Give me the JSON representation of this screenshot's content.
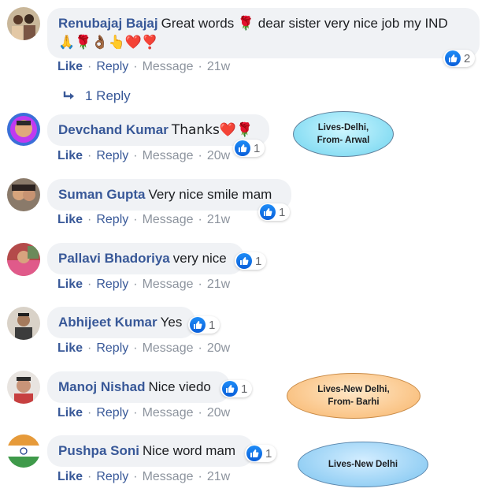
{
  "actions": {
    "like": "Like",
    "reply": "Reply",
    "message": "Message",
    "sep": "·"
  },
  "comments": [
    {
      "name": "Renubajaj Bajaj",
      "text_line1": "Great words 🌹 dear sister very nice job my IND",
      "text_line2": "🙏🌹👌🏾👆❤️❣️",
      "reactions": "2",
      "time": "21w",
      "replies_link": "1 Reply"
    },
    {
      "name": "Devchand Kumar",
      "text": "Thanks❤️🌹",
      "reactions": "1",
      "time": "20w"
    },
    {
      "name": "Suman Gupta",
      "text": "Very nice smile mam",
      "reactions": "1",
      "time": "21w"
    },
    {
      "name": "Pallavi Bhadoriya",
      "text": "very nice",
      "reactions": "1",
      "time": "21w"
    },
    {
      "name": "Abhijeet Kumar",
      "text": "Yes",
      "reactions": "1",
      "time": "20w"
    },
    {
      "name": "Manoj Nishad",
      "text": "Nice viedo",
      "reactions": "1",
      "time": "20w"
    },
    {
      "name": "Pushpa Soni",
      "text": "Nice word mam",
      "reactions": "1",
      "time": "21w"
    }
  ],
  "annotations": {
    "devchand": {
      "line1": "Lives-Delhi,",
      "line2": "From- Arwal"
    },
    "manoj": {
      "line1": "Lives-New Delhi,",
      "line2": "From- Barhi"
    },
    "pushpa": {
      "line1": "Lives-New Delhi"
    }
  },
  "icons": {
    "like": "like-thumb-icon",
    "reply_arrow": "reply-arrow-icon"
  },
  "colors": {
    "link": "#385898",
    "bubble": "#f0f2f5",
    "muted": "#8d949e",
    "like_blue": "#1877f2"
  }
}
